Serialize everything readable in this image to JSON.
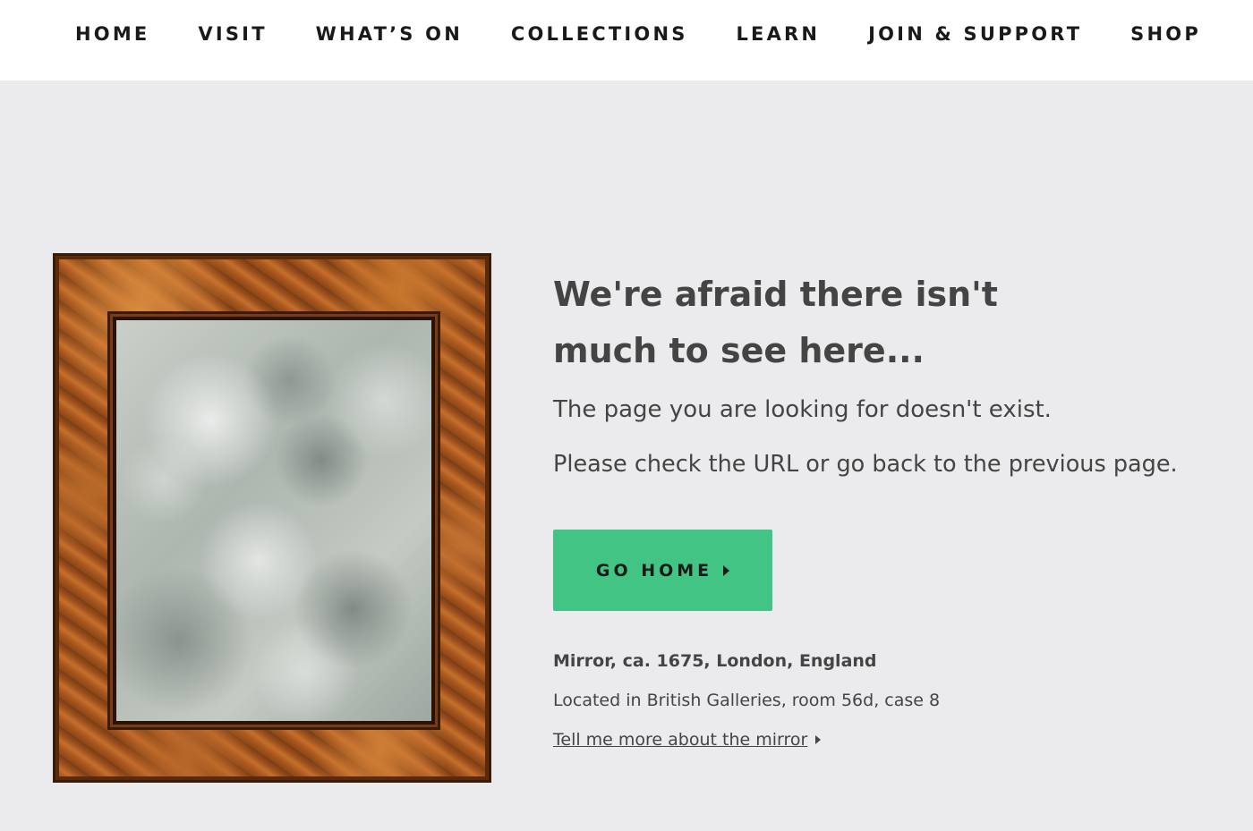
{
  "nav": {
    "items": [
      {
        "label": "HOME"
      },
      {
        "label": "VISIT"
      },
      {
        "label": "WHAT’S ON"
      },
      {
        "label": "COLLECTIONS"
      },
      {
        "label": "LEARN"
      },
      {
        "label": "JOIN & SUPPORT"
      },
      {
        "label": "SHOP"
      }
    ]
  },
  "error": {
    "headline": "We're afraid there isn't much to see here...",
    "message_1": "The page you are looking for doesn't exist.",
    "message_2": "Please check the URL or go back to the previous page.",
    "button_label": "GO HOME",
    "button_icon": "chevron-right-icon"
  },
  "artwork": {
    "image_alt": "mirror-image",
    "caption_title": "Mirror, ca. 1675, London, England",
    "caption_location": "Located in British Galleries, room 56d, case 8",
    "more_link": "Tell me more about the mirror",
    "more_link_icon": "chevron-right-icon"
  },
  "colors": {
    "background": "#ebebed",
    "nav_background": "#ffffff",
    "button": "#42c584",
    "text": "#444444"
  }
}
